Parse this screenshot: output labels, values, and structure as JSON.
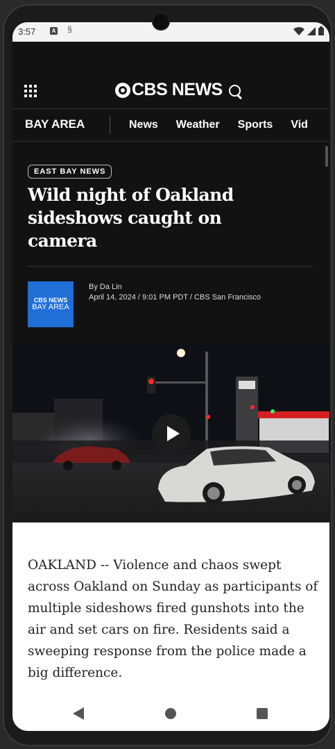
{
  "status": {
    "time": "3:57",
    "icon_a": "A"
  },
  "header": {
    "logo_text": "CBS NEWS"
  },
  "nav": {
    "section": "BAY AREA",
    "items": [
      "News",
      "Weather",
      "Sports",
      "Vid"
    ]
  },
  "article": {
    "tag": "EAST BAY NEWS",
    "headline": "Wild night of Oakland sideshows caught on camera",
    "author": "By Da Lin",
    "dateline": "April 14, 2024 / 9:01 PM PDT / CBS San Francisco",
    "logo_line1": "CBS NEWS",
    "logo_line2": "BAY AREA",
    "body": "OAKLAND -- Violence and chaos swept across Oakland on Sunday as participants of multiple sideshows fired gunshots into the air and set cars on fire. Residents said a sweeping response from the police made a big difference."
  },
  "colors": {
    "header_bg": "#131212",
    "station_blue": "#1f6fd6",
    "page_bg": "#ffffff"
  },
  "icons": [
    "menu-grid-icon",
    "search-icon",
    "play-icon",
    "back-icon",
    "home-icon",
    "recents-icon"
  ]
}
